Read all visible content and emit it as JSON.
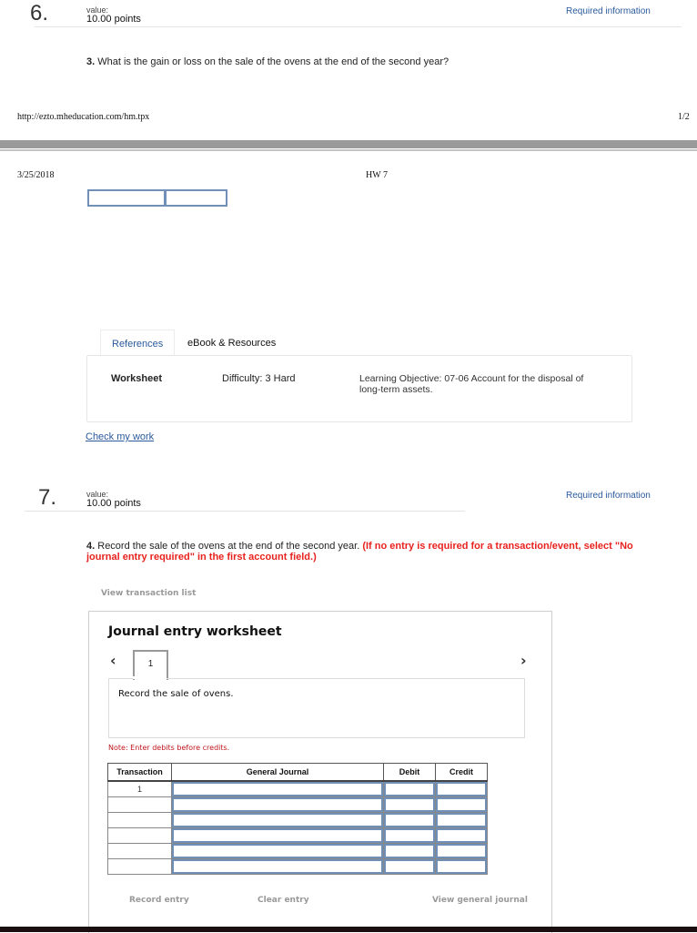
{
  "question6": {
    "number": "6.",
    "value_label": "value:",
    "points": "10.00 points",
    "required_info": "Required information",
    "prompt_number": "3.",
    "prompt_text": " What is the gain or loss on the sale of the ovens at the end of the second year?"
  },
  "print_footer": {
    "url": "http://ezto.mheducation.com/hm.tpx",
    "page": "1/2"
  },
  "print_header": {
    "date": "3/25/2018",
    "title": "HW 7"
  },
  "answer_boxes": [
    "",
    ""
  ],
  "references": {
    "tabs": [
      {
        "label": "References",
        "active": true
      },
      {
        "label": "eBook & Resources",
        "active": false
      }
    ],
    "worksheet": "Worksheet",
    "difficulty": "Difficulty: 3 Hard",
    "learning_objective": "Learning Objective: 07-06 Account for the disposal of long-term assets."
  },
  "check_my_work": "Check my work",
  "question7": {
    "number": "7.",
    "value_label": "value:",
    "points": "10.00 points",
    "required_info": "Required information",
    "prompt_number": "4.",
    "prompt_text": " Record the sale of the ovens at the end of the second year. ",
    "prompt_instruction": "(If no entry is required for a transaction/event, select \"No journal entry required\" in the first account field.)"
  },
  "view_transaction_list": "View transaction list",
  "worksheet": {
    "title": "Journal entry worksheet",
    "prev_icon": "chevron-left",
    "next_icon": "chevron-right",
    "current_tab": "1",
    "description": "Record the sale of ovens.",
    "note": "Note: Enter debits before credits.",
    "columns": [
      "Transaction",
      "General Journal",
      "Debit",
      "Credit"
    ],
    "rows": [
      {
        "transaction": "1",
        "account": "",
        "debit": "",
        "credit": ""
      },
      {
        "transaction": "",
        "account": "",
        "debit": "",
        "credit": ""
      },
      {
        "transaction": "",
        "account": "",
        "debit": "",
        "credit": ""
      },
      {
        "transaction": "",
        "account": "",
        "debit": "",
        "credit": ""
      },
      {
        "transaction": "",
        "account": "",
        "debit": "",
        "credit": ""
      },
      {
        "transaction": "",
        "account": "",
        "debit": "",
        "credit": ""
      }
    ],
    "buttons": {
      "record": "Record entry",
      "clear": "Clear entry",
      "view_journal": "View general journal"
    }
  }
}
